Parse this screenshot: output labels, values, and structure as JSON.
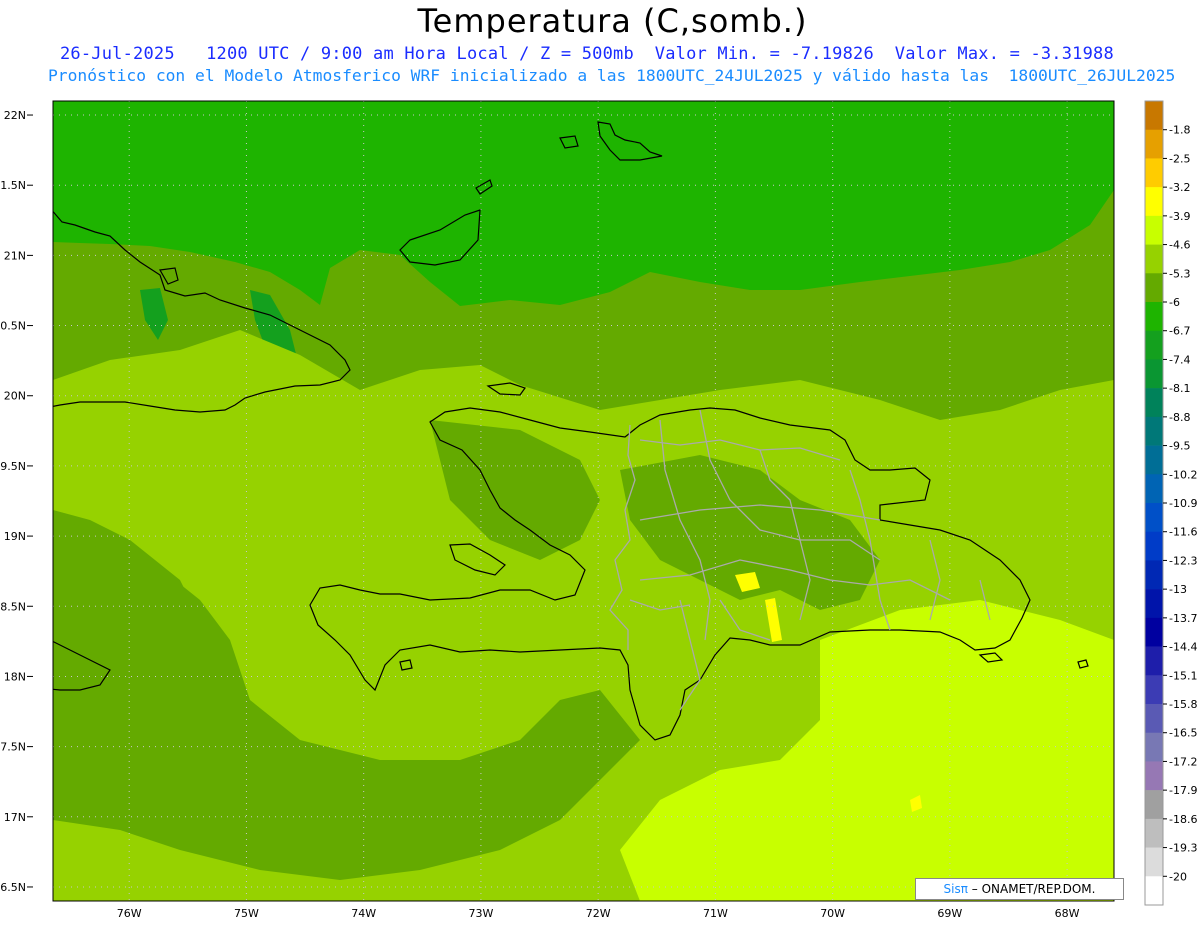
{
  "title": "Temperatura (C,somb.)",
  "subtitle_line1": "26-Jul-2025   1200 UTC / 9:00 am Hora Local / Z = 500mb  Valor Min. = -7.19826  Valor Max. = -3.31988",
  "subtitle_line2": "Pronóstico con el Modelo Atmosferico WRF inicializado a las 1800UTC_24JUL2025 y válido hasta las  1800UTC_26JUL2025",
  "credit": {
    "sis": "Sisπ",
    "rest": " – ONAMET/REP.DOM."
  },
  "lat_labels": [
    "22N",
    "1.5N",
    "21N",
    "0.5N",
    "20N",
    "9.5N",
    "19N",
    "8.5N",
    "18N",
    "7.5N",
    "17N",
    "6.5N"
  ],
  "lon_labels": [
    "76W",
    "75W",
    "74W",
    "73W",
    "72W",
    "71W",
    "70W",
    "69W",
    "68W"
  ],
  "colorbar": {
    "labels": [
      "-1.8",
      "-2.5",
      "-3.2",
      "-3.9",
      "-4.6",
      "-5.3",
      "-6",
      "-6.7",
      "-7.4",
      "-8.1",
      "-8.8",
      "-9.5",
      "-10.2",
      "-10.9",
      "-11.6",
      "-12.3",
      "-13",
      "-13.7",
      "-14.4",
      "-15.1",
      "-15.8",
      "-16.5",
      "-17.2",
      "-17.9",
      "-18.6",
      "-19.3",
      "-20"
    ],
    "colors": [
      "#c87800",
      "#e6a000",
      "#ffcc00",
      "#ffff00",
      "#c8ff00",
      "#96d200",
      "#64aa00",
      "#1eb400",
      "#14a01e",
      "#0a9632",
      "#00825a",
      "#007878",
      "#006e96",
      "#0064b4",
      "#0050c8",
      "#003cc8",
      "#0028b4",
      "#0014aa",
      "#0000a0",
      "#1e1eaa",
      "#3c3cb4",
      "#5a5ab4",
      "#7878b4",
      "#9678b4",
      "#a0a0a0",
      "#bebebe",
      "#dcdcdc",
      "#ffffff"
    ]
  },
  "field_colors": {
    "background": "#64aa00",
    "north": "#1eb400",
    "light": "#96d200",
    "bright": "#c8ff00",
    "yellow": "#ffff00",
    "dark": "#14a01e"
  }
}
